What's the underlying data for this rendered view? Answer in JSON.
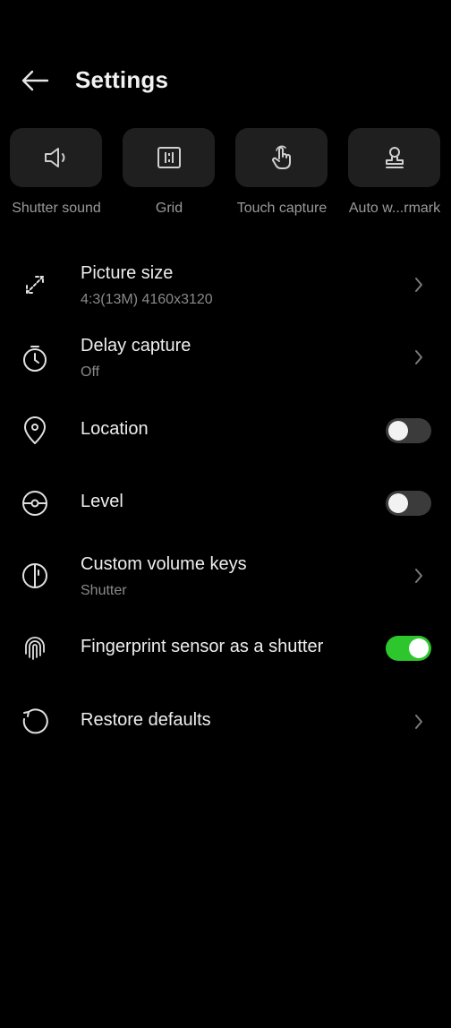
{
  "header": {
    "title": "Settings"
  },
  "quick": [
    {
      "label": "Shutter sound",
      "icon": "speaker-icon"
    },
    {
      "label": "Grid",
      "icon": "grid-icon"
    },
    {
      "label": "Touch capture",
      "icon": "touch-icon"
    },
    {
      "label": "Auto w...rmark",
      "icon": "stamp-icon"
    }
  ],
  "settings": {
    "picture_size": {
      "title": "Picture size",
      "value": "4:3(13M) 4160x3120"
    },
    "delay_capture": {
      "title": "Delay capture",
      "value": "Off"
    },
    "location": {
      "title": "Location",
      "enabled": false
    },
    "level": {
      "title": "Level",
      "enabled": false
    },
    "volume_keys": {
      "title": "Custom volume keys",
      "value": "Shutter"
    },
    "fingerprint": {
      "title": "Fingerprint sensor as a shutter",
      "enabled": true
    },
    "restore": {
      "title": "Restore defaults"
    }
  },
  "colors": {
    "background": "#000000",
    "tile": "#1f1f1f",
    "toggle_on": "#2dc72d",
    "toggle_off": "#3b3b3b"
  }
}
